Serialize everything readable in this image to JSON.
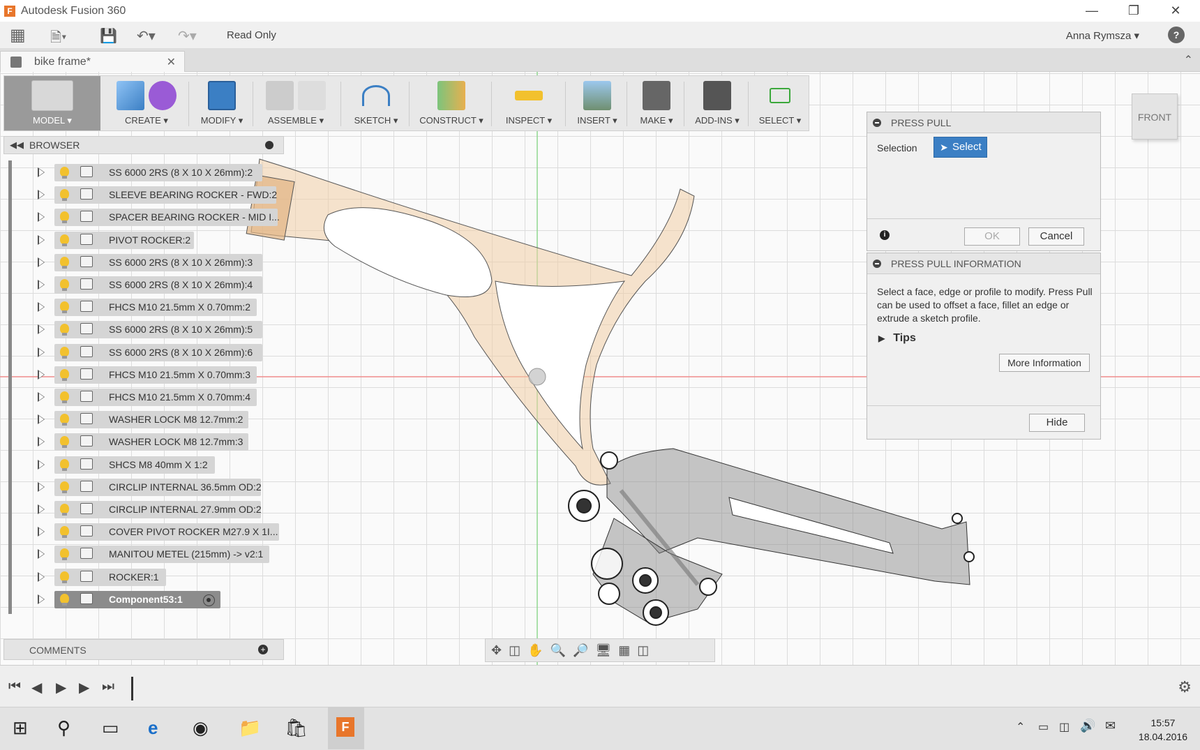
{
  "window": {
    "title": "Autodesk Fusion 360"
  },
  "app_toolbar": {
    "read_only": "Read Only",
    "user": "Anna Rymsza ▾",
    "help": "?"
  },
  "tab": {
    "name": "bike frame*"
  },
  "ribbon": {
    "groups": [
      {
        "label": "MODEL ▾"
      },
      {
        "label": "CREATE ▾"
      },
      {
        "label": "MODIFY ▾"
      },
      {
        "label": "ASSEMBLE ▾"
      },
      {
        "label": "SKETCH ▾"
      },
      {
        "label": "CONSTRUCT ▾"
      },
      {
        "label": "INSPECT ▾"
      },
      {
        "label": "INSERT ▾"
      },
      {
        "label": "MAKE ▾"
      },
      {
        "label": "ADD-INS ▾"
      },
      {
        "label": "SELECT ▾"
      }
    ]
  },
  "browser": {
    "title": "BROWSER",
    "items": [
      {
        "label": "SS 6000 2RS (8 X 10 X 26mm):2"
      },
      {
        "label": "SLEEVE BEARING ROCKER - FWD:2"
      },
      {
        "label": "SPACER BEARING ROCKER - MID I..."
      },
      {
        "label": "PIVOT ROCKER:2"
      },
      {
        "label": "SS 6000 2RS (8 X 10 X 26mm):3"
      },
      {
        "label": "SS 6000 2RS (8 X 10 X 26mm):4"
      },
      {
        "label": "FHCS M10 21.5mm X 0.70mm:2"
      },
      {
        "label": "SS 6000 2RS (8 X 10 X 26mm):5"
      },
      {
        "label": "SS 6000 2RS (8 X 10 X 26mm):6"
      },
      {
        "label": "FHCS M10 21.5mm X 0.70mm:3"
      },
      {
        "label": "FHCS M10 21.5mm X 0.70mm:4"
      },
      {
        "label": "WASHER LOCK M8 12.7mm:2"
      },
      {
        "label": "WASHER LOCK M8 12.7mm:3"
      },
      {
        "label": "SHCS M8 40mm X 1:2"
      },
      {
        "label": "CIRCLIP INTERNAL 36.5mm OD:2"
      },
      {
        "label": "CIRCLIP INTERNAL 27.9mm OD:2"
      },
      {
        "label": "COVER PIVOT ROCKER M27.9 X 1I..."
      },
      {
        "label": "MANITOU METEL (215mm) -> v2:1"
      },
      {
        "label": "ROCKER:1"
      },
      {
        "label": "Component53:1"
      }
    ]
  },
  "comments": {
    "title": "COMMENTS"
  },
  "press_pull": {
    "title": "PRESS PULL",
    "selection_label": "Selection",
    "select_button": "Select",
    "ok": "OK",
    "cancel": "Cancel"
  },
  "press_pull_info": {
    "title": "PRESS PULL INFORMATION",
    "text": "Select a face, edge or profile to modify.  Press Pull can be used to offset a face, fillet an edge or extrude a sketch profile.",
    "tips": "Tips",
    "more_info": "More Information",
    "hide": "Hide"
  },
  "viewcube": {
    "face": "FRONT"
  },
  "taskbar": {
    "time": "15:57",
    "date": "18.04.2016"
  }
}
